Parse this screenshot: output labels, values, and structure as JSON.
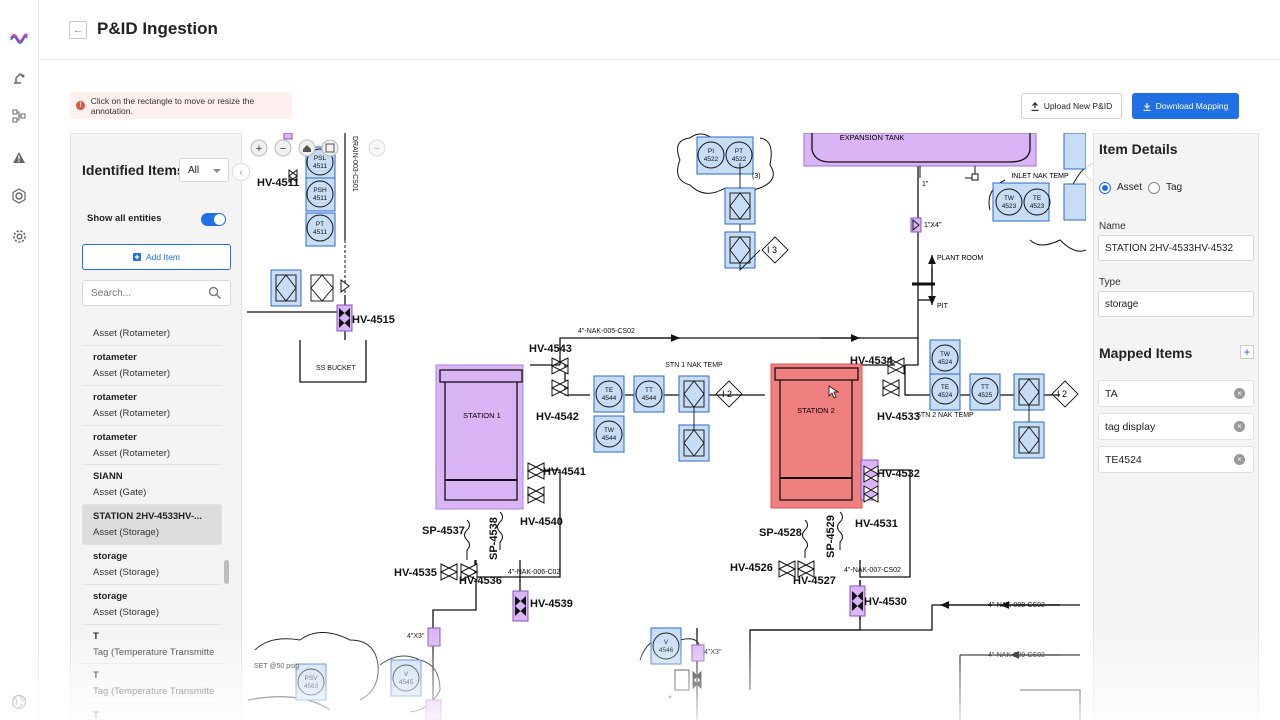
{
  "app": {
    "title": "P&ID Ingestion",
    "brand_color": "#1f6fe5",
    "nav_icons": [
      "logo-icon",
      "robot-arm-icon",
      "hierarchy-icon",
      "warning-icon",
      "target-icon",
      "gear-icon",
      "globe-icon"
    ]
  },
  "alert": {
    "text": "Click on the rectangle to move or resize the annotation."
  },
  "toolbar": {
    "upload_label": "Upload New P&ID",
    "download_label": "Download Mapping"
  },
  "identified": {
    "title": "Identified Items",
    "filter_value": "All",
    "show_all_label": "Show all entities",
    "show_all_on": true,
    "add_label": "Add Item",
    "search_placeholder": "Search...",
    "items": [
      {
        "name": "",
        "type": "Asset (Rotameter)"
      },
      {
        "name": "rotameter",
        "type": "Asset (Rotameter)"
      },
      {
        "name": "rotameter",
        "type": "Asset (Rotameter)"
      },
      {
        "name": "rotameter",
        "type": "Asset (Rotameter)"
      },
      {
        "name": "SIANN",
        "type": "Asset (Gate)"
      },
      {
        "name": "STATION 2HV-4533HV-...",
        "type": "Asset (Storage)"
      },
      {
        "name": "storage",
        "type": "Asset (Storage)"
      },
      {
        "name": "storage",
        "type": "Asset (Storage)"
      },
      {
        "name": "T",
        "type": "Tag (Temperature Transmitte"
      },
      {
        "name": "T",
        "type": "Tag (Temperature Transmitte"
      },
      {
        "name": "T",
        "type": ""
      }
    ]
  },
  "details": {
    "title": "Item Details",
    "radio_asset": "Asset",
    "radio_tag": "Tag",
    "selected": "Asset",
    "name_label": "Name",
    "name_value": "STATION 2HV-4533HV-4532",
    "type_label": "Type",
    "type_value": "storage",
    "mapped_title": "Mapped Items",
    "mapped": [
      "TA",
      "tag display",
      "TE4524"
    ]
  },
  "diagram": {
    "labels": {
      "hv4511": "HV-4511",
      "hv4515": "HV-4515",
      "hv4543": "HV-4543",
      "hv4542": "HV-4542",
      "hv4541": "HV-4541",
      "hv4540": "HV-4540",
      "hv4534": "HV-4534",
      "hv4533": "HV-4533",
      "hv4532": "HV-4532",
      "hv4531": "HV-4531",
      "hv4535": "HV-4535",
      "hv4536": "HV-4536",
      "hv4539": "HV-4539",
      "hv4526": "HV-4526",
      "hv4527": "HV-4527",
      "hv4530": "HV-4530",
      "sp4537": "SP-4537",
      "sp4538": "SP-4538",
      "sp4528": "SP-4528",
      "sp4529": "SP-4529",
      "station1": "STATION 1",
      "station2": "STATION 2",
      "expansion": "EXPANSION TANK",
      "ss_bucket": "SS BUCKET",
      "plant_room": "PLANT ROOM",
      "pit": "PIT",
      "inlet": "INLET NAK TEMP",
      "stn1": "STN 1 NAK TEMP",
      "stn2": "STN 2 NAK TEMP",
      "line005": "4\"-NAK-005-CS02",
      "line006": "4\"-NAK-006-C02",
      "line007": "4\"-NAK-007-CS02",
      "line008": "4\"-NAK-008-CS02",
      "line009": "4\"-NAK-009-CS02",
      "drain": "DRAIN-003-CS01",
      "set": "SET @50 psig",
      "one_inch": "1\"",
      "one_x4": "1\"X4\"",
      "four_x3": "4\"X3\"",
      "three": "(3)"
    },
    "instruments": [
      {
        "id": "psl",
        "l1": "PSL",
        "l2": "4511"
      },
      {
        "id": "psh",
        "l1": "PSH",
        "l2": "4511"
      },
      {
        "id": "pt4511",
        "l1": "PT",
        "l2": "4511"
      },
      {
        "id": "pi4522",
        "l1": "PI",
        "l2": "4522"
      },
      {
        "id": "pt4522",
        "l1": "PT",
        "l2": "4522"
      },
      {
        "id": "te4544",
        "l1": "TE",
        "l2": "4544"
      },
      {
        "id": "tt4544",
        "l1": "TT",
        "l2": "4544"
      },
      {
        "id": "tw4544",
        "l1": "TW",
        "l2": "4544"
      },
      {
        "id": "tw4524",
        "l1": "TW",
        "l2": "4524"
      },
      {
        "id": "te4524",
        "l1": "TE",
        "l2": "4524"
      },
      {
        "id": "tt4525",
        "l1": "TT",
        "l2": "4525"
      },
      {
        "id": "tw4523",
        "l1": "TW",
        "l2": "4523"
      },
      {
        "id": "te4523",
        "l1": "TE",
        "l2": "4523"
      },
      {
        "id": "v4546",
        "l1": "V",
        "l2": "4546"
      },
      {
        "id": "v4545",
        "l1": "V",
        "l2": "4545"
      },
      {
        "id": "psv4563",
        "l1": "PSV",
        "l2": "4563"
      }
    ]
  }
}
